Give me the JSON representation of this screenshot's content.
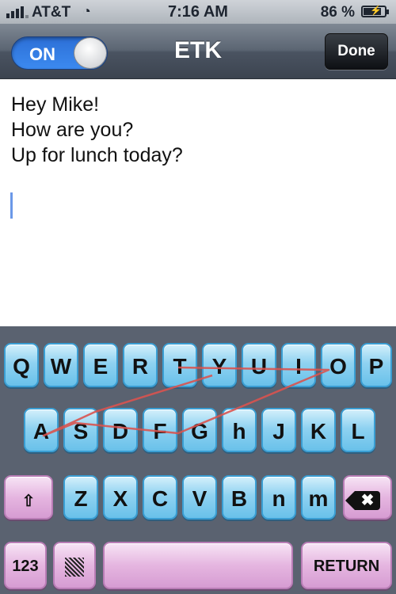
{
  "status_bar": {
    "carrier": "AT&T",
    "time": "7:16 AM",
    "battery": "86 %",
    "battery_level": 0.86,
    "icons": [
      "signal-bars-icon",
      "wifi-icon",
      "battery-charging-icon"
    ]
  },
  "nav": {
    "toggle_label": "ON",
    "toggle_state": true,
    "title": "ETK",
    "done_label": "Done"
  },
  "message": {
    "lines": [
      "Hey Mike!",
      "How are you?",
      "Up for lunch today?"
    ]
  },
  "keyboard": {
    "row1": [
      "Q",
      "W",
      "E",
      "R",
      "T",
      "Y",
      "U",
      "I",
      "O",
      "P"
    ],
    "row2": [
      "A",
      "S",
      "D",
      "F",
      "G",
      "h",
      "J",
      "K",
      "L"
    ],
    "row3": [
      "Z",
      "X",
      "C",
      "V",
      "B",
      "n",
      "m"
    ],
    "numbers_label": "123",
    "return_label": "RETURN",
    "icons": [
      "shift-icon",
      "delete-icon",
      "emoji-hatch-icon"
    ],
    "colors": {
      "letter_key": "#8fd2f1",
      "function_key": "#e5b5e0",
      "swipe_trace": "#d9534f"
    }
  }
}
